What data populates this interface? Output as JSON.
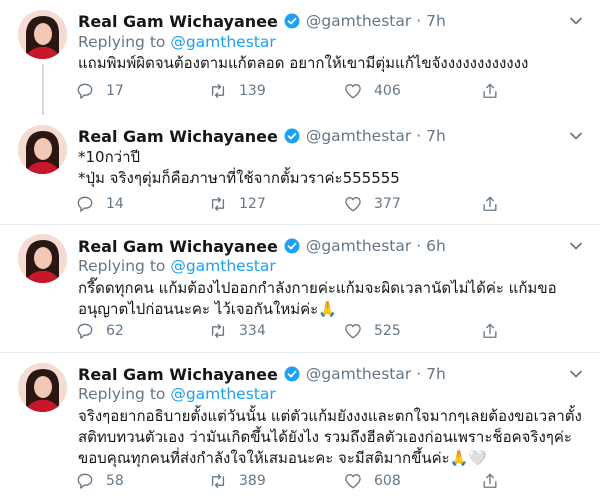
{
  "tweets": [
    {
      "name": "Real Gam Wichayanee",
      "handle": "@gamthestar",
      "sep": "·",
      "time": "7h",
      "replying_label": "Replying to",
      "replying_to": "@gamthestar",
      "text": "แถมพิมพ์ผิดจนต้องตามแก้ตลอด อยากให้เขามีตุ่มแก้ไขจังงงงงงงงงงงง",
      "replies": "17",
      "retweets": "139",
      "likes": "406"
    },
    {
      "name": "Real Gam Wichayanee",
      "handle": "@gamthestar",
      "sep": "·",
      "time": "7h",
      "text": "*10กว่าปี\n*ปุ่ม จริงๆตุ่มก็คือภาษาที่ใช้จากตั้มวราค่ะ555555",
      "replies": "14",
      "retweets": "127",
      "likes": "377"
    },
    {
      "name": "Real Gam Wichayanee",
      "handle": "@gamthestar",
      "sep": "·",
      "time": "6h",
      "replying_label": "Replying to",
      "replying_to": "@gamthestar",
      "text": "กรี๊ดดทุกคน แก้มต้องไปออกกำลังกายค่ะแก้มจะผิดเวลานัดไม่ได้ค่ะ แก้มขออนุญาตไปก่อนนะคะ ไว้เจอกันใหม่ค่ะ🙏",
      "replies": "62",
      "retweets": "334",
      "likes": "525"
    },
    {
      "name": "Real Gam Wichayanee",
      "handle": "@gamthestar",
      "sep": "·",
      "time": "7h",
      "replying_label": "Replying to",
      "replying_to": "@gamthestar",
      "text": "จริงๆอยากอธิบายตั้งแต่วันนั้น แต่ตัวแก้มยังงงและตกใจมากๆเลยต้องขอเวลาตั้งสติทบทวนตัวเอง ว่ามันเกิดขึ้นได้ยังไง รวมถึงฮีลตัวเองก่อนเพราะช็อคจริงๆค่ะ ขอบคุณทุกคนที่ส่งกำลังใจให้เสมอนะคะ จะมีสติมากขึ้นค่ะ🙏🤍",
      "replies": "58",
      "retweets": "389",
      "likes": "608"
    }
  ],
  "icons": {
    "verified": "verified-badge-icon",
    "caret": "chevron-down-icon",
    "reply": "reply-bubble-icon",
    "retweet": "retweet-icon",
    "like": "heart-icon",
    "share": "share-icon"
  },
  "colors": {
    "accent": "#1da1f2",
    "muted": "#657786",
    "text": "#14171a",
    "divider": "#e6ecf0"
  }
}
